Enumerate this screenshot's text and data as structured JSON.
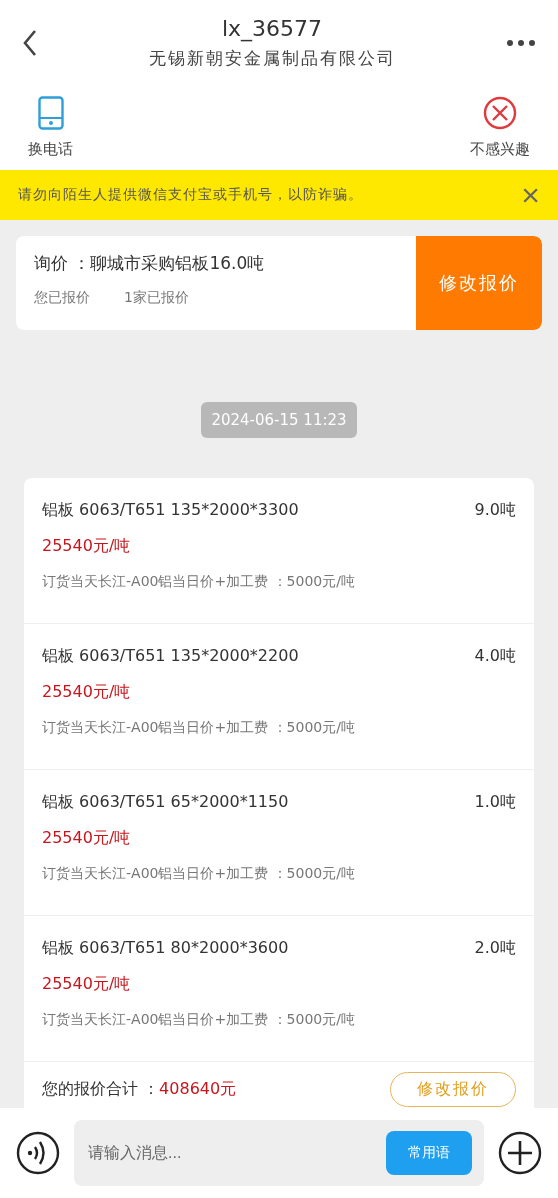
{
  "header": {
    "title": "lx_36577",
    "subtitle": "无锡新朝安金属制品有限公司"
  },
  "actions": [
    {
      "kind": "phone",
      "label": "换电话"
    },
    {
      "kind": "reject",
      "label": "不感兴趣"
    }
  ],
  "warning": {
    "text": "请勿向陌生人提供微信支付宝或手机号，以防诈骗。",
    "close": "×"
  },
  "inquiry": {
    "title": "询价 ：聊城市采购铝板16.0吨",
    "status": "您已报价",
    "count": "1家已报价",
    "button": "修改报价"
  },
  "timestamp": "2024-06-15 11:23",
  "quote": {
    "items": [
      {
        "name": "铝板 6063/T651 135*2000*3300",
        "qty": "9.0吨",
        "price": "25540元/吨",
        "note": "订货当天长江-A00铝当日价+加工费 ：5000元/吨"
      },
      {
        "name": "铝板 6063/T651 135*2000*2200",
        "qty": "4.0吨",
        "price": "25540元/吨",
        "note": "订货当天长江-A00铝当日价+加工费 ：5000元/吨"
      },
      {
        "name": "铝板 6063/T651 65*2000*1150",
        "qty": "1.0吨",
        "price": "25540元/吨",
        "note": "订货当天长江-A00铝当日价+加工费 ：5000元/吨"
      },
      {
        "name": "铝板 6063/T651 80*2000*3600",
        "qty": "2.0吨",
        "price": "25540元/吨",
        "note": "订货当天长江-A00铝当日价+加工费 ：5000元/吨"
      }
    ],
    "total_label": "您的报价合计 ：",
    "total": "408640元",
    "button": "修改报价"
  },
  "input_bar": {
    "placeholder": "请输入消息...",
    "phrases_button": "常用语"
  }
}
